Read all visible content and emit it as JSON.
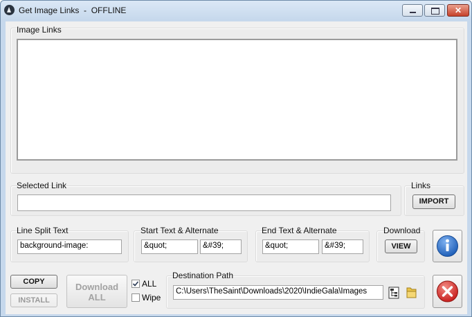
{
  "window": {
    "title": "Get Image Links  -  OFFLINE",
    "minimize_glyph": "",
    "close_glyph": "✕"
  },
  "image_links": {
    "label": "Image Links",
    "value": ""
  },
  "selected_link": {
    "label": "Selected Link",
    "value": ""
  },
  "links": {
    "label": "Links",
    "import_label": "IMPORT"
  },
  "line_split": {
    "label": "Line Split Text",
    "value": "background-image:"
  },
  "start_text": {
    "label": "Start Text & Alternate",
    "value": "&quot;",
    "alternate": "&#39;"
  },
  "end_text": {
    "label": "End Text & Alternate",
    "value": "&quot;",
    "alternate": "&#39;"
  },
  "download": {
    "label": "Download",
    "view_label": "VIEW"
  },
  "actions": {
    "copy_label": "COPY",
    "install_label": "INSTALL",
    "download_all_line1": "Download",
    "download_all_line2": "ALL",
    "all_label": "ALL",
    "all_checked": true,
    "wipe_label": "Wipe",
    "wipe_checked": false
  },
  "destination": {
    "label": "Destination Path",
    "value": "C:\\Users\\TheSaint\\Downloads\\2020\\IndieGala\\Images"
  },
  "colors": {
    "info_blue": "#1f5fb8",
    "exit_red": "#c8201f"
  },
  "icons": [
    "app-icon",
    "info-icon",
    "exit-icon",
    "folder-tree-icon",
    "folder-icon"
  ]
}
